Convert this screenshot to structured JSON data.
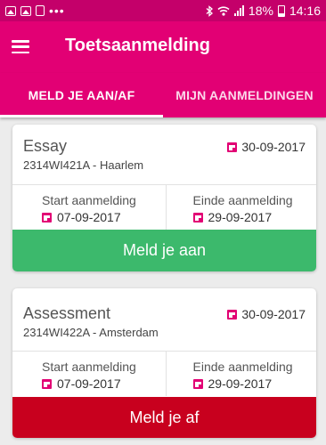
{
  "status_bar": {
    "icons_left": [
      "image-icon",
      "gallery-icon",
      "document-icon",
      "more-dots-icon"
    ],
    "icons_right": [
      "bluetooth-icon",
      "wifi-icon",
      "signal-icon",
      "battery-icon"
    ],
    "battery": "18%",
    "time": "14:16",
    "color": "#c4006a"
  },
  "app_bar": {
    "title": "Toetsaanmelding",
    "color": "#e20074"
  },
  "tabs": [
    {
      "label": "MELD JE AAN/AF",
      "active": true
    },
    {
      "label": "MIJN AANMELDINGEN",
      "active": false
    }
  ],
  "cards": [
    {
      "title": "Essay",
      "code_location": "2314WI421A - Haarlem",
      "date": "30-09-2017",
      "start_label": "Start aanmelding",
      "start_date": "07-09-2017",
      "end_label": "Einde aanmelding",
      "end_date": "29-09-2017",
      "action_label": "Meld je aan",
      "action_color": "#3cb96c"
    },
    {
      "title": "Assessment",
      "code_location": "2314WI422A - Amsterdam",
      "date": "30-09-2017",
      "start_label": "Start aanmelding",
      "start_date": "07-09-2017",
      "end_label": "Einde aanmelding",
      "end_date": "29-09-2017",
      "action_label": "Meld je af",
      "action_color": "#c8001e"
    }
  ]
}
